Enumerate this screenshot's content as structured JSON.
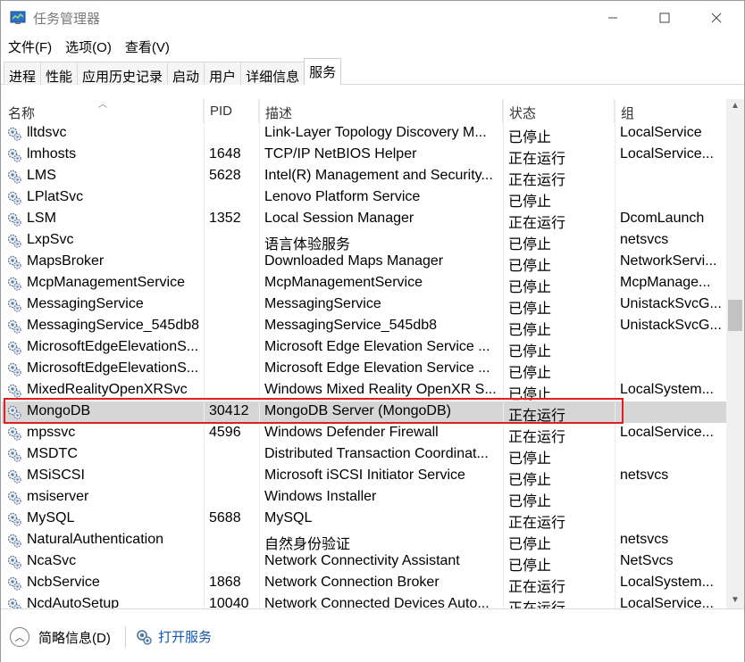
{
  "window": {
    "title": "任务管理器",
    "minimize_icon": "minimize-icon",
    "maximize_icon": "maximize-icon",
    "close_icon": "close-icon"
  },
  "menu": [
    "文件(F)",
    "选项(O)",
    "查看(V)"
  ],
  "tabs": [
    "进程",
    "性能",
    "应用历史记录",
    "启动",
    "用户",
    "详细信息",
    "服务"
  ],
  "active_tab": "服务",
  "columns": {
    "name": "名称",
    "pid": "PID",
    "desc": "描述",
    "status": "状态",
    "group": "组"
  },
  "rows": [
    {
      "name": "lltdsvc",
      "pid": "",
      "desc": "Link-Layer Topology Discovery M...",
      "status": "已停止",
      "group": "LocalService"
    },
    {
      "name": "lmhosts",
      "pid": "1648",
      "desc": "TCP/IP NetBIOS Helper",
      "status": "正在运行",
      "group": "LocalService..."
    },
    {
      "name": "LMS",
      "pid": "5628",
      "desc": "Intel(R) Management and Security...",
      "status": "正在运行",
      "group": ""
    },
    {
      "name": "LPlatSvc",
      "pid": "",
      "desc": "Lenovo Platform Service",
      "status": "已停止",
      "group": ""
    },
    {
      "name": "LSM",
      "pid": "1352",
      "desc": "Local Session Manager",
      "status": "正在运行",
      "group": "DcomLaunch"
    },
    {
      "name": "LxpSvc",
      "pid": "",
      "desc": "语言体验服务",
      "status": "已停止",
      "group": "netsvcs"
    },
    {
      "name": "MapsBroker",
      "pid": "",
      "desc": "Downloaded Maps Manager",
      "status": "已停止",
      "group": "NetworkServi..."
    },
    {
      "name": "McpManagementService",
      "pid": "",
      "desc": "McpManagementService",
      "status": "已停止",
      "group": "McpManage..."
    },
    {
      "name": "MessagingService",
      "pid": "",
      "desc": "MessagingService",
      "status": "已停止",
      "group": "UnistackSvcG..."
    },
    {
      "name": "MessagingService_545db8",
      "pid": "",
      "desc": "MessagingService_545db8",
      "status": "已停止",
      "group": "UnistackSvcG..."
    },
    {
      "name": "MicrosoftEdgeElevationS...",
      "pid": "",
      "desc": "Microsoft Edge Elevation Service ...",
      "status": "已停止",
      "group": ""
    },
    {
      "name": "MicrosoftEdgeElevationS...",
      "pid": "",
      "desc": "Microsoft Edge Elevation Service ...",
      "status": "已停止",
      "group": ""
    },
    {
      "name": "MixedRealityOpenXRSvc",
      "pid": "",
      "desc": "Windows Mixed Reality OpenXR S...",
      "status": "已停止",
      "group": "LocalSystem..."
    },
    {
      "name": "MongoDB",
      "pid": "30412",
      "desc": "MongoDB Server (MongoDB)",
      "status": "正在运行",
      "group": "",
      "selected": true
    },
    {
      "name": "mpssvc",
      "pid": "4596",
      "desc": "Windows Defender Firewall",
      "status": "正在运行",
      "group": "LocalService..."
    },
    {
      "name": "MSDTC",
      "pid": "",
      "desc": "Distributed Transaction Coordinat...",
      "status": "已停止",
      "group": ""
    },
    {
      "name": "MSiSCSI",
      "pid": "",
      "desc": "Microsoft iSCSI Initiator Service",
      "status": "已停止",
      "group": "netsvcs"
    },
    {
      "name": "msiserver",
      "pid": "",
      "desc": "Windows Installer",
      "status": "已停止",
      "group": ""
    },
    {
      "name": "MySQL",
      "pid": "5688",
      "desc": "MySQL",
      "status": "正在运行",
      "group": ""
    },
    {
      "name": "NaturalAuthentication",
      "pid": "",
      "desc": "自然身份验证",
      "status": "已停止",
      "group": "netsvcs"
    },
    {
      "name": "NcaSvc",
      "pid": "",
      "desc": "Network Connectivity Assistant",
      "status": "已停止",
      "group": "NetSvcs"
    },
    {
      "name": "NcbService",
      "pid": "1868",
      "desc": "Network Connection Broker",
      "status": "正在运行",
      "group": "LocalSystem..."
    },
    {
      "name": "NcdAutoSetup",
      "pid": "10040",
      "desc": "Network Connected Devices Auto...",
      "status": "正在运行",
      "group": "LocalService..."
    }
  ],
  "footer": {
    "fewer_details": "简略信息(D)",
    "open_services": "打开服务"
  }
}
